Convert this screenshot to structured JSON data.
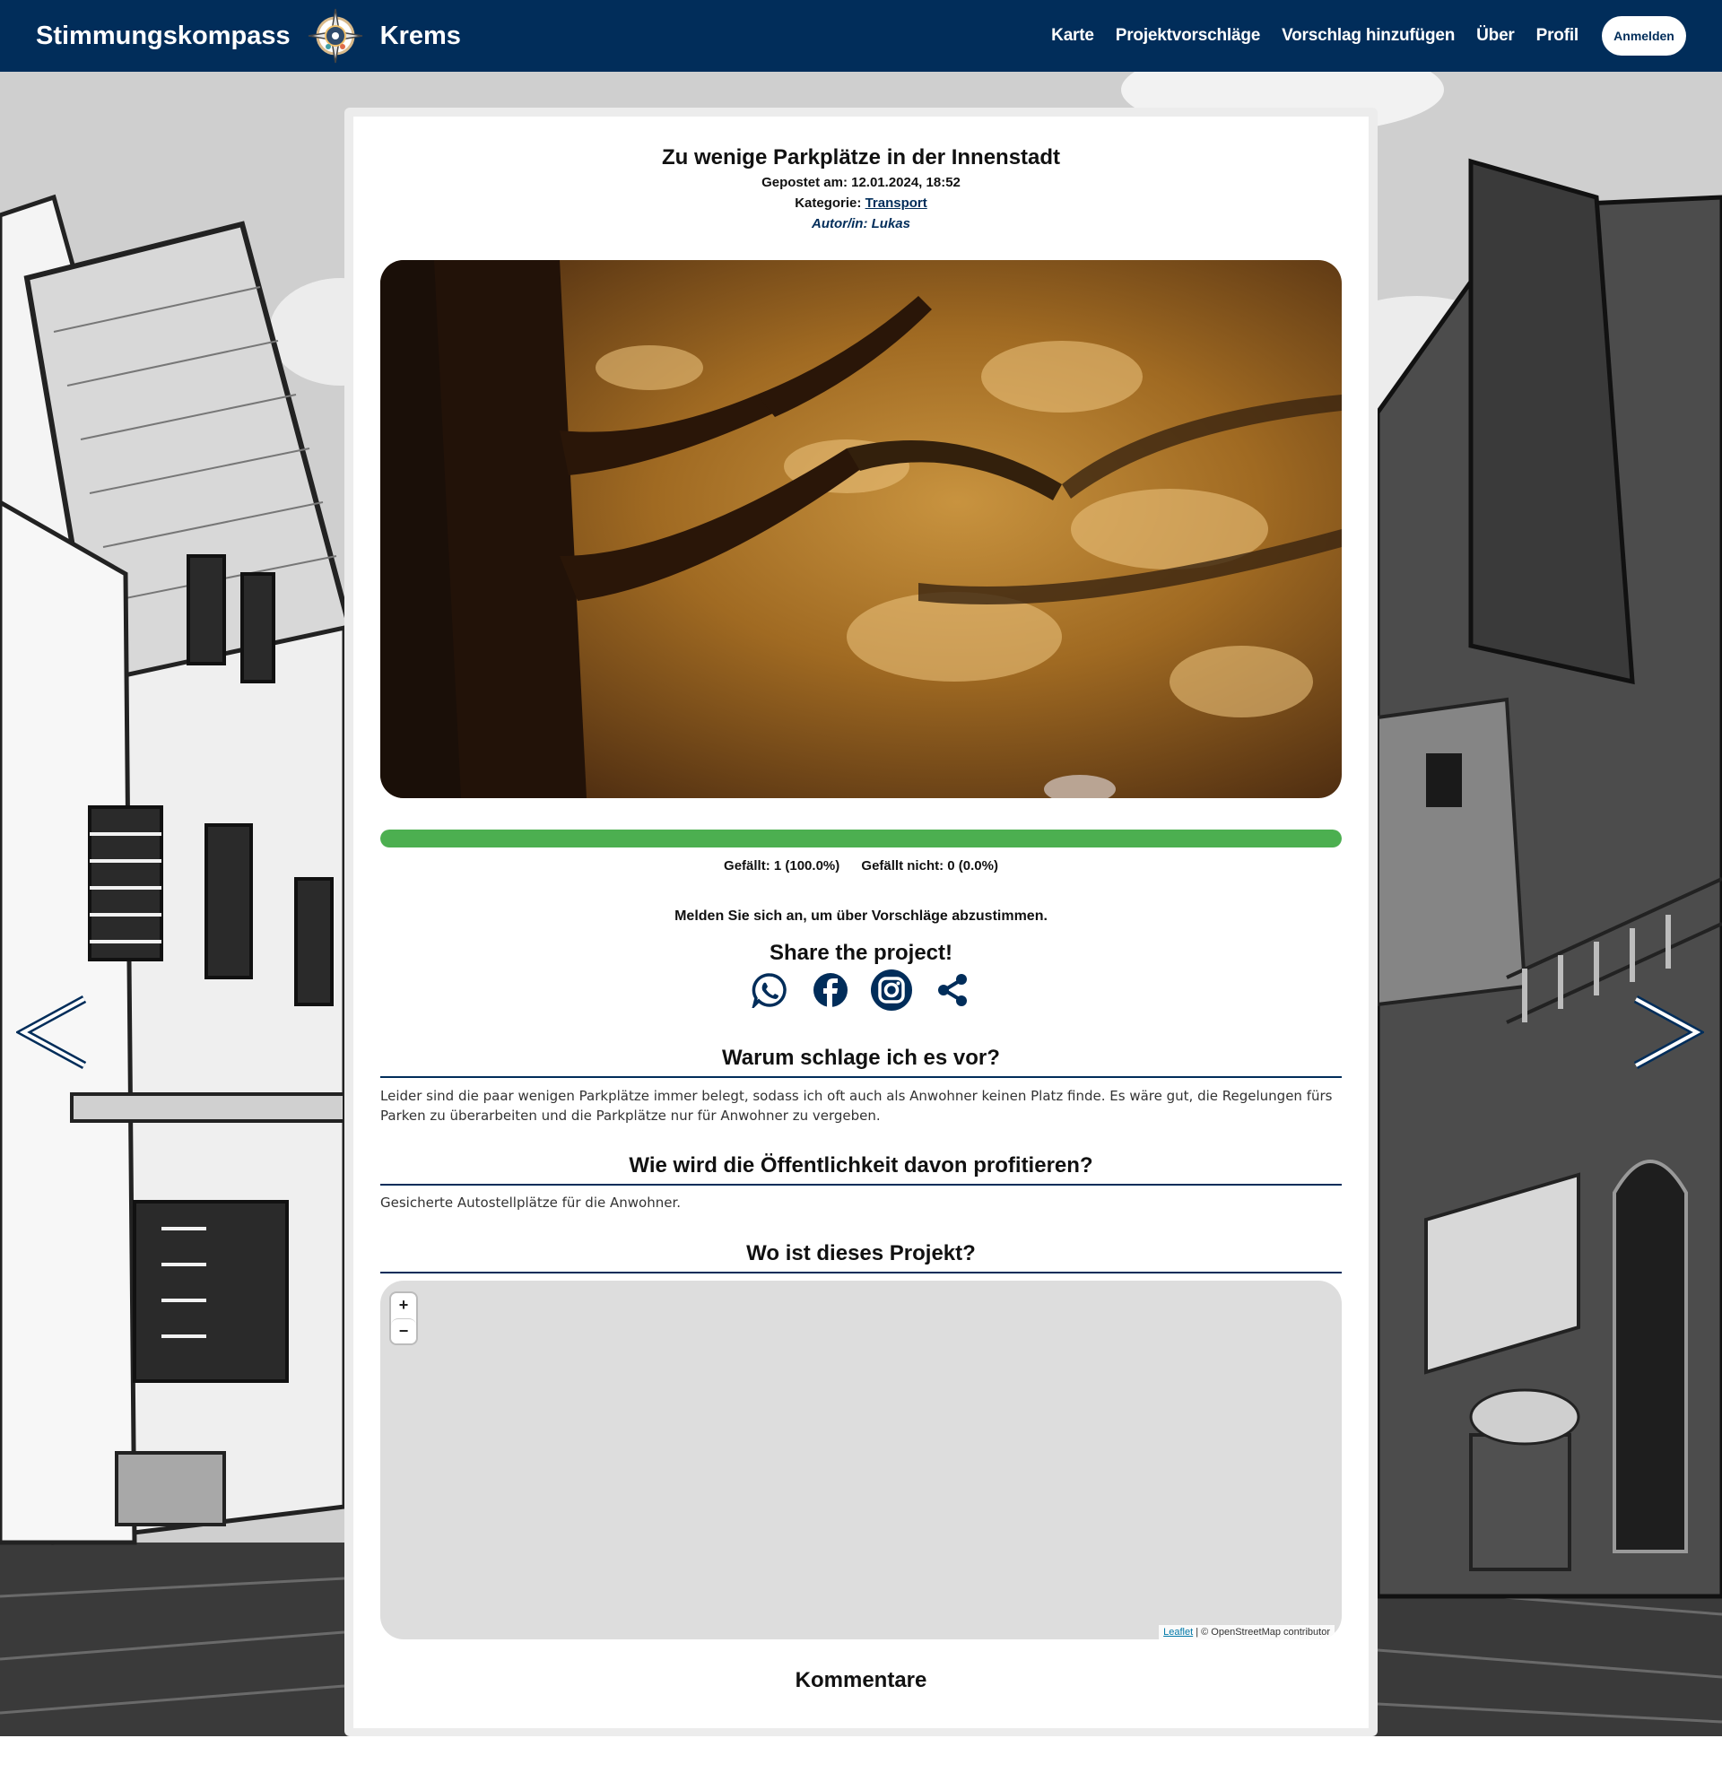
{
  "header": {
    "brand_left": "Stimmungskompass",
    "brand_right": "Krems",
    "logo_icon": "compass-logo-icon",
    "nav": [
      "Karte",
      "Projektvorschläge",
      "Vorschlag hinzufügen",
      "Über",
      "Profil"
    ],
    "login_label": "Anmelden",
    "background_color": "#012d5a"
  },
  "proposal": {
    "title": "Zu wenige Parkplätze in der Innenstadt",
    "posted_label": "Gepostet am: 12.01.2024, 18:52",
    "category_prefix": "Kategorie:",
    "category": "Transport",
    "author": "Autor/in: Lukas",
    "image_icon": "autumn-tree-photo"
  },
  "votes": {
    "like_fraction": 1.0,
    "likes_text": "Gefällt: 1 (100.0%)",
    "dislikes_text": "Gefällt nicht: 0 (0.0%)",
    "bar_color": "#4caf50",
    "login_note": "Melden Sie sich an, um über Vorschläge abzustimmen."
  },
  "share": {
    "title": "Share the project!",
    "icons": [
      "whatsapp-icon",
      "facebook-icon",
      "instagram-icon",
      "share-icon"
    ]
  },
  "sections": {
    "why_title": "Warum schlage ich es vor?",
    "why_body": "Leider sind die paar wenigen Parkplätze immer belegt, sodass ich oft auch als Anwohner keinen Platz finde. Es wäre gut, die Regelungen fürs Parken zu überarbeiten und die Parkplätze nur für Anwohner zu vergeben.",
    "benefit_title": "Wie wird die Öffentlichkeit davon profitieren?",
    "benefit_body": "Gesicherte Autostellplätze für die Anwohner.",
    "where_title": "Wo ist dieses Projekt?"
  },
  "map": {
    "zoom_in": "+",
    "zoom_out": "−",
    "attribution_link": "Leaflet",
    "attribution_text": "| © OpenStreetMap contributor"
  },
  "comments": {
    "title": "Kommentare"
  },
  "navigation": {
    "prev_icon": "chevron-left-icon",
    "next_icon": "chevron-right-icon"
  }
}
